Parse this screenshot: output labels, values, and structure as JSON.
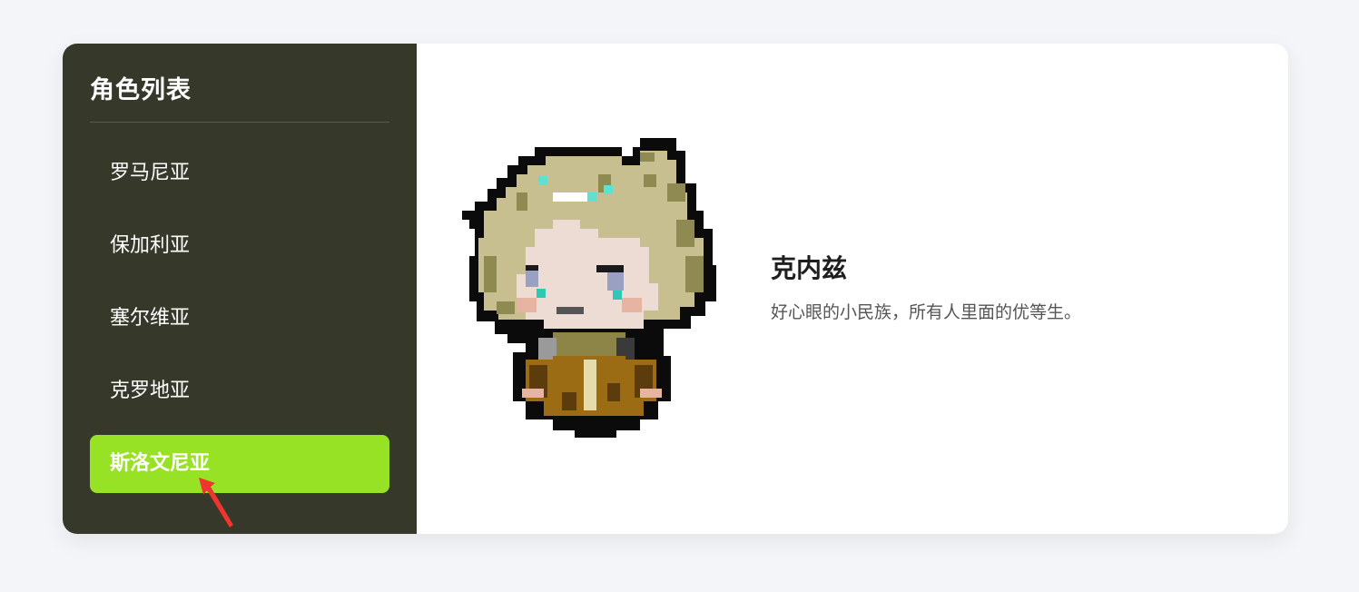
{
  "sidebar": {
    "title": "角色列表",
    "items": [
      {
        "label": "罗马尼亚",
        "active": false
      },
      {
        "label": "保加利亚",
        "active": false
      },
      {
        "label": "塞尔维亚",
        "active": false
      },
      {
        "label": "克罗地亚",
        "active": false
      },
      {
        "label": "斯洛文尼亚",
        "active": true
      }
    ]
  },
  "character": {
    "name": "克内兹",
    "description": "好心眼的小民族，所有人里面的优等生。",
    "image_icon": "pixel-character-portrait"
  },
  "colors": {
    "page_bg": "#f4f5f8",
    "sidebar_bg": "#363829",
    "active_item_bg": "#97e224",
    "cursor": "#f0342e"
  }
}
